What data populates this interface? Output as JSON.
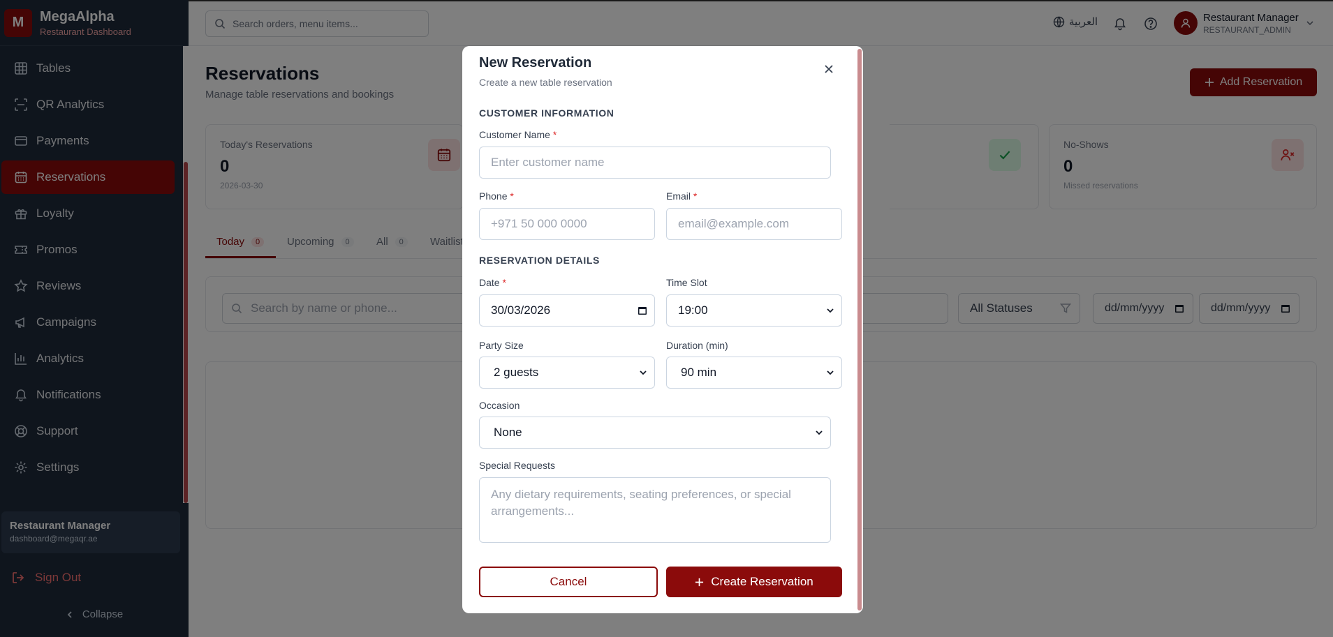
{
  "colors": {
    "brand": "#8b0b0b",
    "sidebar_bg": "#1e2a3b"
  },
  "brand": {
    "logo_letter": "M",
    "name": "MegaAlpha",
    "subtitle": "Restaurant Dashboard"
  },
  "sidebar": {
    "items": [
      {
        "label": "Tables",
        "icon": "grid-icon"
      },
      {
        "label": "QR Analytics",
        "icon": "scan-icon"
      },
      {
        "label": "Payments",
        "icon": "credit-card-icon"
      },
      {
        "label": "Reservations",
        "icon": "calendar-icon",
        "active": true
      },
      {
        "label": "Loyalty",
        "icon": "gift-icon"
      },
      {
        "label": "Promos",
        "icon": "ticket-icon"
      },
      {
        "label": "Reviews",
        "icon": "star-icon"
      },
      {
        "label": "Campaigns",
        "icon": "megaphone-icon"
      },
      {
        "label": "Analytics",
        "icon": "bar-chart-icon"
      },
      {
        "label": "Notifications",
        "icon": "bell-icon"
      },
      {
        "label": "Support",
        "icon": "lifebuoy-icon"
      },
      {
        "label": "Settings",
        "icon": "gear-icon"
      }
    ],
    "user": {
      "name": "Restaurant Manager",
      "email": "dashboard@megaqr.ae"
    },
    "sign_out": "Sign Out",
    "collapse": "Collapse"
  },
  "topbar": {
    "search_placeholder": "Search orders, menu items...",
    "language": "العربية",
    "user_name": "Restaurant Manager",
    "user_role": "RESTAURANT_ADMIN"
  },
  "page": {
    "title": "Reservations",
    "subtitle": "Manage table reservations and bookings",
    "add_button": "Add Reservation",
    "stats": [
      {
        "label": "Today's Reservations",
        "value": "0",
        "sub": "2026-03-30"
      },
      {
        "label": "No-Shows",
        "value": "0",
        "sub": "Missed reservations"
      }
    ],
    "tabs": [
      {
        "label": "Today",
        "count": "0"
      },
      {
        "label": "Upcoming",
        "count": "0"
      },
      {
        "label": "All",
        "count": "0"
      },
      {
        "label": "Waitlist",
        "count": ""
      }
    ],
    "filters": {
      "search_placeholder": "Search by name or phone...",
      "status": "All Statuses",
      "date_from": "dd/mm/yyyy",
      "date_to": "dd/mm/yyyy"
    }
  },
  "modal": {
    "title": "New Reservation",
    "subtitle": "Create a new table reservation",
    "section_customer": "CUSTOMER INFORMATION",
    "customer_name_label": "Customer Name",
    "customer_name_placeholder": "Enter customer name",
    "phone_label": "Phone",
    "phone_placeholder": "+971 50 000 0000",
    "email_label": "Email",
    "email_placeholder": "email@example.com",
    "section_details": "RESERVATION DETAILS",
    "date_label": "Date",
    "date_value": "30/03/2026",
    "time_label": "Time Slot",
    "time_value": "19:00",
    "party_label": "Party Size",
    "party_value": "2 guests",
    "duration_label": "Duration (min)",
    "duration_value": "90 min",
    "occasion_label": "Occasion",
    "occasion_value": "None",
    "requests_label": "Special Requests",
    "requests_placeholder": "Any dietary requirements, seating preferences, or special arrangements...",
    "required_mark": "*",
    "cancel": "Cancel",
    "create": "Create Reservation"
  }
}
